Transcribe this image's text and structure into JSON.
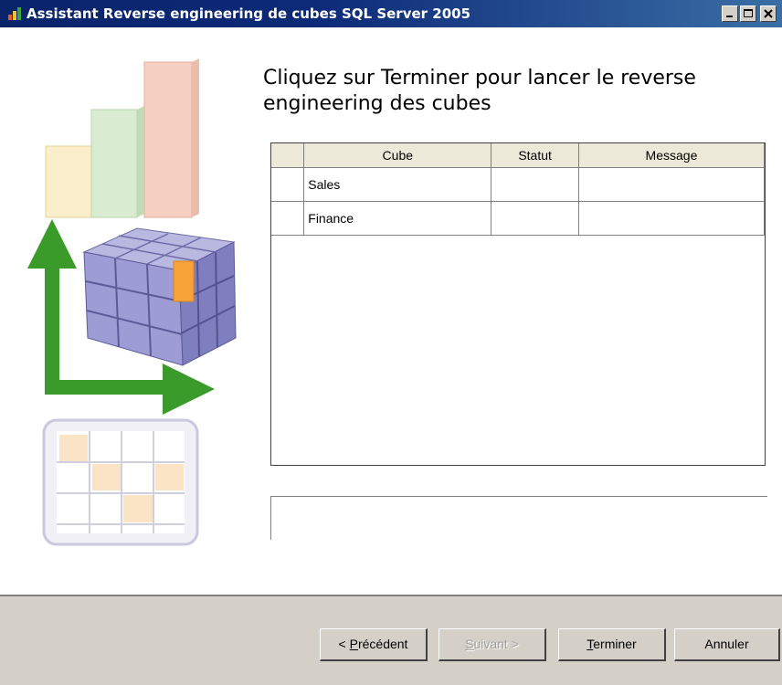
{
  "window": {
    "title": "Assistant Reverse engineering de cubes SQL Server 2005",
    "controls": [
      "minimize",
      "maximize",
      "close"
    ]
  },
  "heading": "Cliquez sur Terminer pour lancer le reverse engineering des cubes",
  "grid": {
    "columns": [
      "",
      "Cube",
      "Statut",
      "Message"
    ],
    "rows": [
      {
        "cube": "Sales",
        "statut": "",
        "message": ""
      },
      {
        "cube": "Finance",
        "statut": "",
        "message": ""
      }
    ]
  },
  "message_area": {
    "text": ""
  },
  "buttons": {
    "previous": {
      "prefix": "< ",
      "mnemonic": "P",
      "rest": "récédent"
    },
    "next": {
      "mnemonic": "S",
      "rest": "uivant >",
      "enabled": false
    },
    "finish": {
      "mnemonic": "T",
      "rest": "erminer"
    },
    "cancel": {
      "label": "Annuler"
    }
  },
  "colors": {
    "titlebar_start": "#0a246a",
    "titlebar_end": "#3a6ea5",
    "dialog_face": "#d4d0c8",
    "arrow_green": "#3a9a2a",
    "cube_purple": "#8f8fc8",
    "cube_highlight": "#f7a33a"
  },
  "icons": {
    "app": "app-icon",
    "illustration": [
      "bar-chart-icon",
      "cube-icon",
      "arrow-icon",
      "table-grid-icon"
    ]
  }
}
